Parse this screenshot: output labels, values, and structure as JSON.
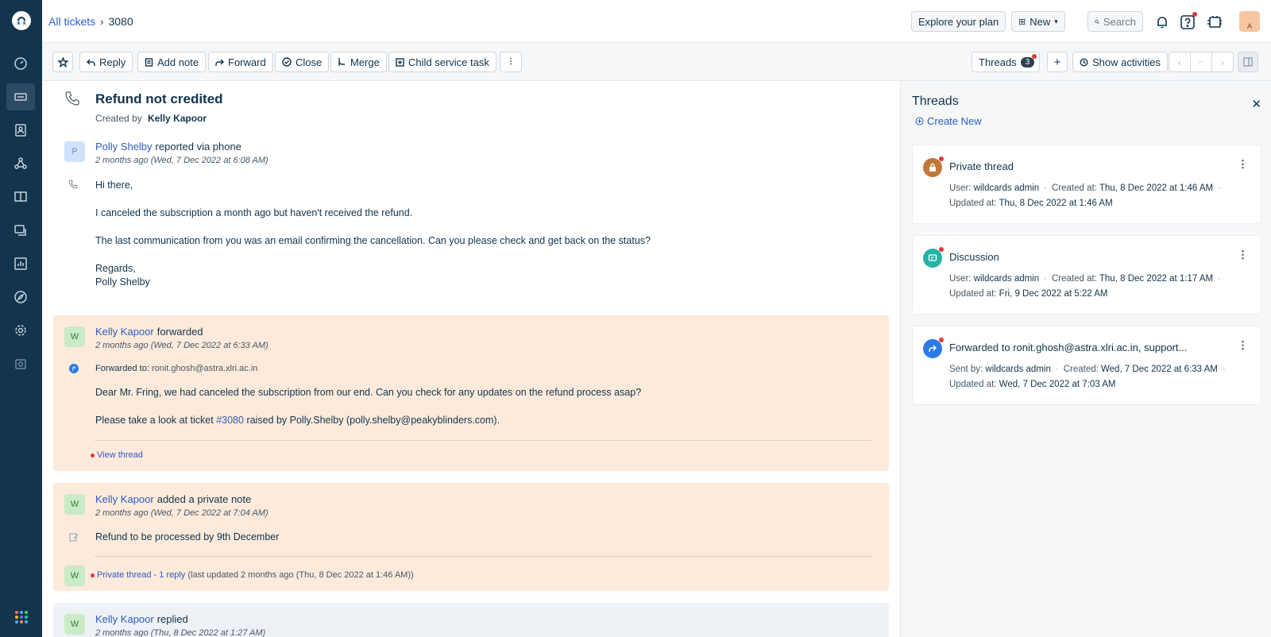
{
  "breadcrumb": {
    "parent": "All tickets",
    "current": "3080"
  },
  "header": {
    "explore_label": "Explore your plan",
    "new_label": "New",
    "search_placeholder": "Search",
    "avatar_letter": "A"
  },
  "toolbar": {
    "reply": "Reply",
    "add_note": "Add note",
    "forward": "Forward",
    "close": "Close",
    "merge": "Merge",
    "child_task": "Child service task",
    "threads": "Threads",
    "threads_count": "3",
    "show_activities": "Show activities",
    "pager_mid": "--"
  },
  "ticket": {
    "subject": "Refund not credited",
    "created_by_label": "Created by",
    "created_by": "Kelly Kapoor"
  },
  "messages": [
    {
      "avatar": "P",
      "author": "Polly Shelby",
      "action": "reported via phone",
      "time": "2 months ago (Wed, 7 Dec 2022 at 6:08 AM)",
      "lines": [
        "Hi there,",
        "I canceled the subscription a month ago but haven't received the refund.",
        "The last communication from you was an email confirming the cancellation. Can you please check and get back on the status?",
        "Regards,",
        "Polly Shelby"
      ]
    },
    {
      "avatar": "W",
      "author": "Kelly Kapoor",
      "action": "forwarded",
      "time": "2 months ago (Wed, 7 Dec 2022 at 6:33 AM)",
      "forwarded_label": "Forwarded to:",
      "forwarded_to": "ronit.ghosh@astra.xlri.ac.in",
      "line1": "Dear Mr. Fring, we had canceled the subscription from our end. Can you check for any updates on the refund process asap?",
      "line2_pre": "Please take a look at ticket",
      "line2_link": "#3080",
      "line2_post": "raised by Polly.Shelby (polly.shelby@peakyblinders.com).",
      "view_thread": "View thread"
    },
    {
      "avatar": "W",
      "author": "Kelly Kapoor",
      "action": "added a private note",
      "time": "2 months ago (Wed, 7 Dec 2022 at 7:04 AM)",
      "body": "Refund to be processed by 9th December",
      "thread_avatar": "W",
      "thread_link": "Private thread - 1 reply",
      "thread_meta": "(last updated 2 months ago (Thu, 8 Dec 2022 at 1:46 AM))"
    },
    {
      "avatar": "W",
      "author": "Kelly Kapoor",
      "action": "replied",
      "time": "2 months ago (Thu, 8 Dec 2022 at 1:27 AM)"
    }
  ],
  "threads_panel": {
    "title": "Threads",
    "create_new": "Create New",
    "items": [
      {
        "title": "Private thread",
        "icon": "lock-icon",
        "color": "#c0773a",
        "l1a_label": "User:",
        "l1a": "wildcards admin",
        "l1b_label": "Created at:",
        "l1b": "Thu, 8 Dec 2022 at 1:46 AM",
        "l2_label": "Updated at:",
        "l2": "Thu, 8 Dec 2022 at 1:46 AM"
      },
      {
        "title": "Discussion",
        "icon": "chat-icon",
        "color": "#24b3a4",
        "l1a_label": "User:",
        "l1a": "wildcards admin",
        "l1b_label": "Created at:",
        "l1b": "Thu, 8 Dec 2022 at 1:17 AM",
        "l2_label": "Updated at:",
        "l2": "Fri, 9 Dec 2022 at 5:22 AM"
      },
      {
        "title": "Forwarded to ronit.ghosh@astra.xlri.ac.in, support...",
        "icon": "forward-icon",
        "color": "#2c7be5",
        "l1a_label": "Sent by:",
        "l1a": "wildcards admin",
        "l1b_label": "Created:",
        "l1b": "Wed, 7 Dec 2022 at 6:33 AM",
        "l2_label": "Updated at:",
        "l2": "Wed, 7 Dec 2022 at 7:03 AM"
      }
    ]
  }
}
